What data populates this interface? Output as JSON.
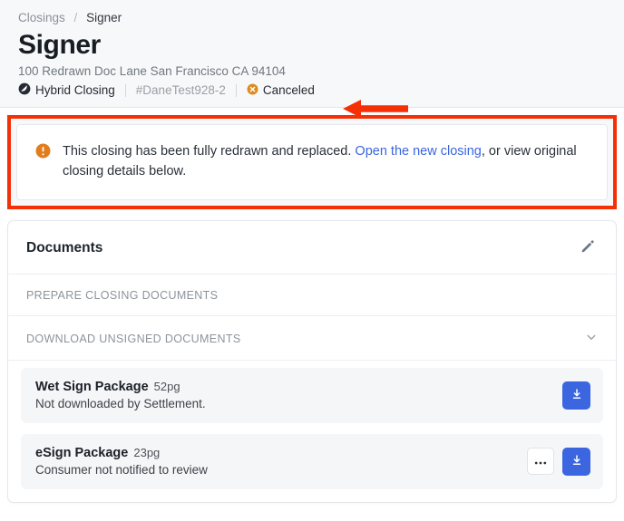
{
  "header": {
    "breadcrumb": {
      "parent": "Closings",
      "separator": "/",
      "current": "Signer"
    },
    "title": "Signer",
    "address": "100 Redrawn Doc Lane San Francisco CA 94104",
    "closing_type": "Hybrid Closing",
    "closing_type_icon": "hybrid-closing-icon",
    "reference_id": "#DaneTest928-2",
    "status": "Canceled",
    "status_icon": "cancel-circle-icon",
    "status_color": "#e08a1e"
  },
  "annotation": {
    "arrow_icon": "red-arrow-left-icon",
    "box_icon": "red-highlight-box",
    "color": "#f52f06"
  },
  "alert": {
    "icon": "warning-circle-icon",
    "icon_color": "#e07e1e",
    "text_before": "This closing has been fully redrawn and replaced.",
    "link_text": "Open the new closing",
    "text_after": ", or view original closing details below.",
    "link_color": "#3b66e0"
  },
  "documents_card": {
    "title": "Documents",
    "edit_icon": "pencil-icon",
    "sections": [
      {
        "label": "PREPARE CLOSING DOCUMENTS",
        "icon": null
      },
      {
        "label": "DOWNLOAD UNSIGNED DOCUMENTS",
        "icon": "chevron-down-icon"
      }
    ],
    "documents": [
      {
        "name": "Wet Sign Package",
        "pages": "52pg",
        "status": "Not downloaded by Settlement.",
        "has_more": false,
        "more_icon": "ellipsis-icon",
        "download_icon": "download-icon"
      },
      {
        "name": "eSign Package",
        "pages": "23pg",
        "status": "Consumer not notified to review",
        "has_more": true,
        "more_icon": "ellipsis-icon",
        "download_icon": "download-icon"
      }
    ]
  }
}
